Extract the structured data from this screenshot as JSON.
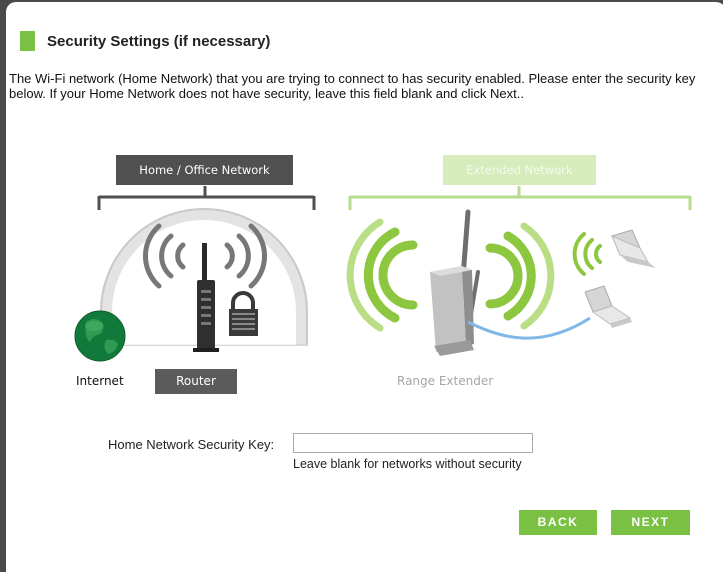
{
  "page": {
    "title": "Security Settings (if necessary)",
    "description": "The Wi-Fi network (Home Network) that you are trying to connect to has security enabled. Please enter the security key below. If your Home Network does not have security, leave this field blank and click Next.."
  },
  "diagram": {
    "home_network_label": "Home / Office Network",
    "extended_network_label": "Extended Network",
    "internet_label": "Internet",
    "router_label": "Router",
    "range_extender_label": "Range Extender"
  },
  "form": {
    "key_label": "Home Network Security Key:",
    "key_value": "",
    "key_hint": "Leave blank for networks without security"
  },
  "buttons": {
    "back": "BACK",
    "next": "NEXT"
  },
  "colors": {
    "accent": "#7ac143",
    "dark_tag": "#505050",
    "light_tag": "#d7ecbc"
  }
}
